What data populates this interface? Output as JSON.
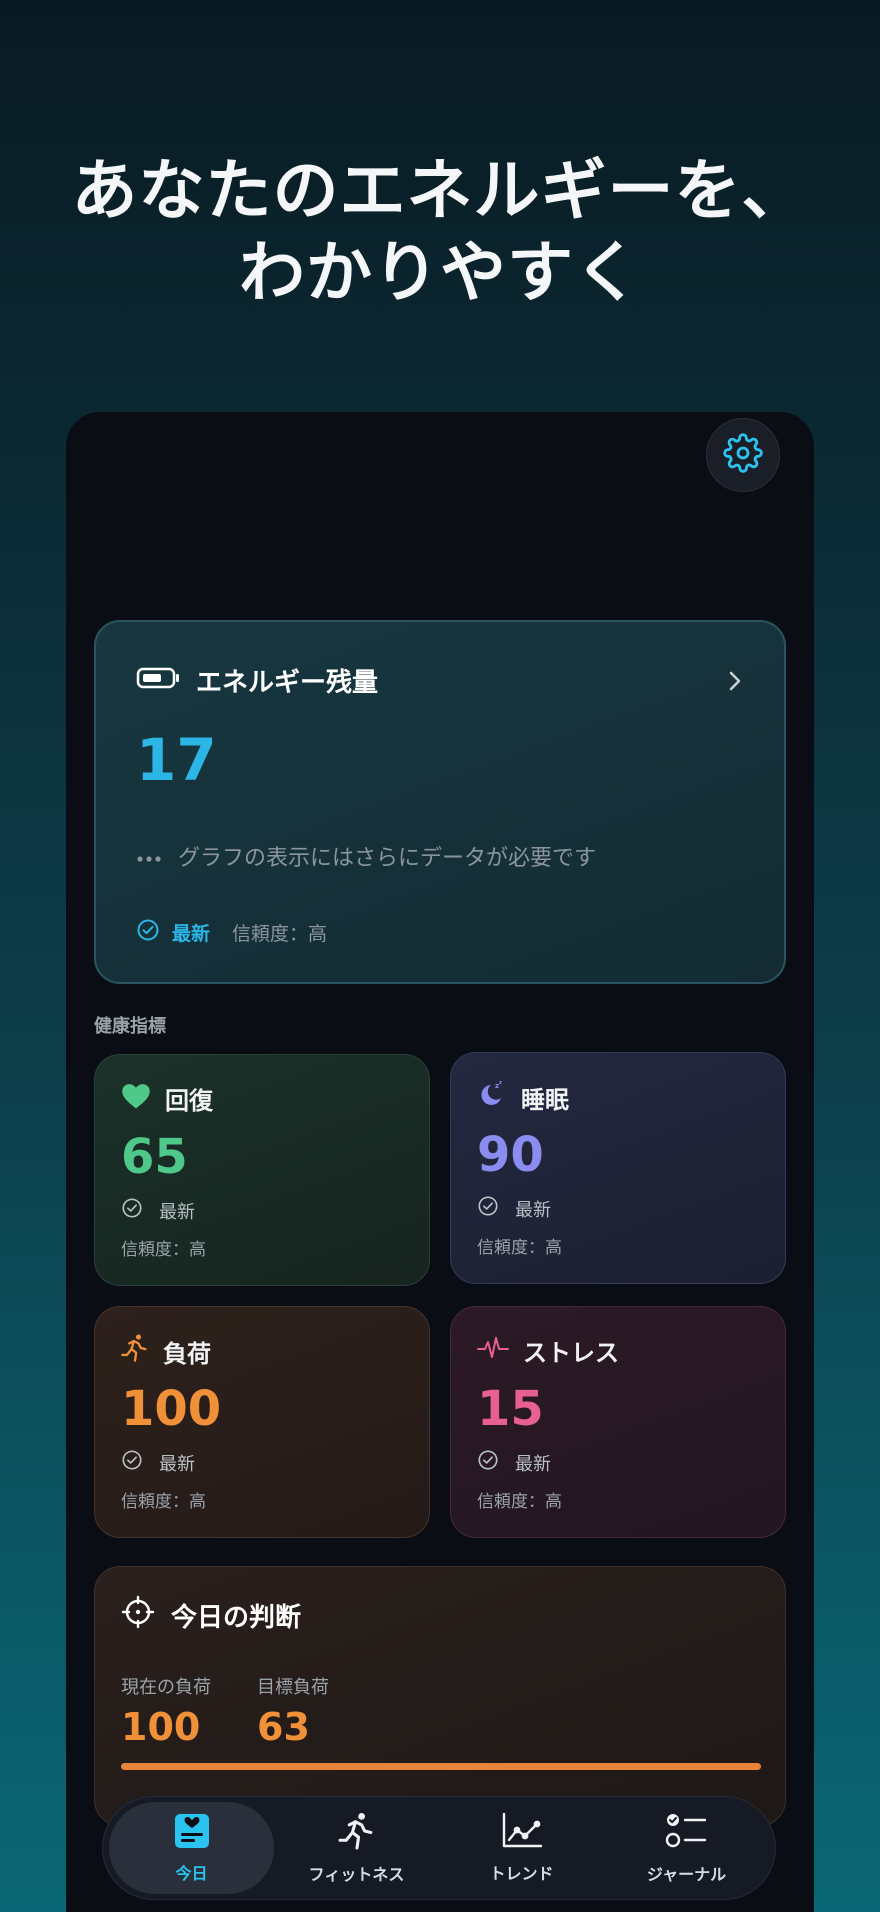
{
  "headline": {
    "line1": "あなたのエネルギーを、",
    "line2": "わかりやすく"
  },
  "energy": {
    "title": "エネルギー残量",
    "value": "17",
    "note": "グラフの表示にはさらにデータが必要です",
    "latest": "最新",
    "confidence": "信頼度：高",
    "accent": "#2bb6e6"
  },
  "section": {
    "label": "健康指標"
  },
  "metrics": {
    "recovery": {
      "title": "回復",
      "value": "65",
      "latest": "最新",
      "confidence": "信頼度：高",
      "color": "#4fc98a"
    },
    "sleep": {
      "title": "睡眠",
      "value": "90",
      "latest": "最新",
      "confidence": "信頼度：高",
      "color": "#8a8cf0"
    },
    "load": {
      "title": "負荷",
      "value": "100",
      "latest": "最新",
      "confidence": "信頼度：高",
      "color": "#f0913a"
    },
    "stress": {
      "title": "ストレス",
      "value": "15",
      "latest": "最新",
      "confidence": "信頼度：高",
      "color": "#e8608f"
    }
  },
  "decision": {
    "title": "今日の判断",
    "current_label": "現在の負荷",
    "current_value": "100",
    "target_label": "目標負荷",
    "target_value": "63"
  },
  "nav": {
    "items": [
      {
        "label": "今日",
        "icon": "today-icon"
      },
      {
        "label": "フィットネス",
        "icon": "fitness-icon"
      },
      {
        "label": "トレンド",
        "icon": "trend-icon"
      },
      {
        "label": "ジャーナル",
        "icon": "journal-icon"
      }
    ]
  }
}
